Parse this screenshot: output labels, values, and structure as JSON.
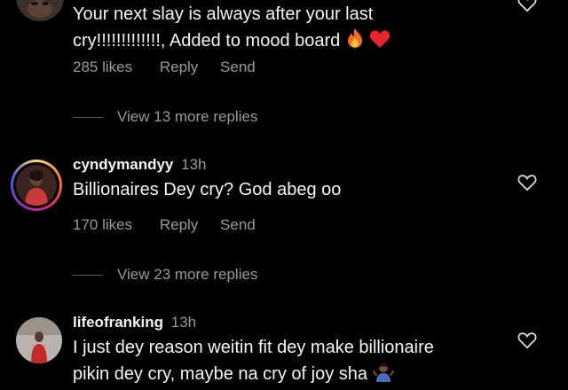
{
  "comments": [
    {
      "text_lines": [
        "Your next slay is always after your last",
        "cry!!!!!!!!!!!!!, Added to mood board"
      ],
      "emojis": [
        "fire-icon",
        "red-heart-icon"
      ],
      "likes": "285 likes",
      "reply": "Reply",
      "send": "Send",
      "view_more": "View 13 more replies"
    },
    {
      "username": "cyndymandyy",
      "time": "13h",
      "text_lines": [
        "Billionaires Dey cry? God abeg oo"
      ],
      "likes": "170 likes",
      "reply": "Reply",
      "send": "Send",
      "view_more": "View 23 more replies"
    },
    {
      "username": "lifeofranking",
      "time": "13h",
      "text_lines": [
        "I just dey reason weitin fit dey make billionaire",
        "pikin dey cry, maybe na cry of joy sha"
      ],
      "emojis": [
        "person-shrugging-icon"
      ]
    }
  ],
  "colors": {
    "background": "#000000",
    "text": "#f5f5f5",
    "muted": "#9a9a9a"
  }
}
